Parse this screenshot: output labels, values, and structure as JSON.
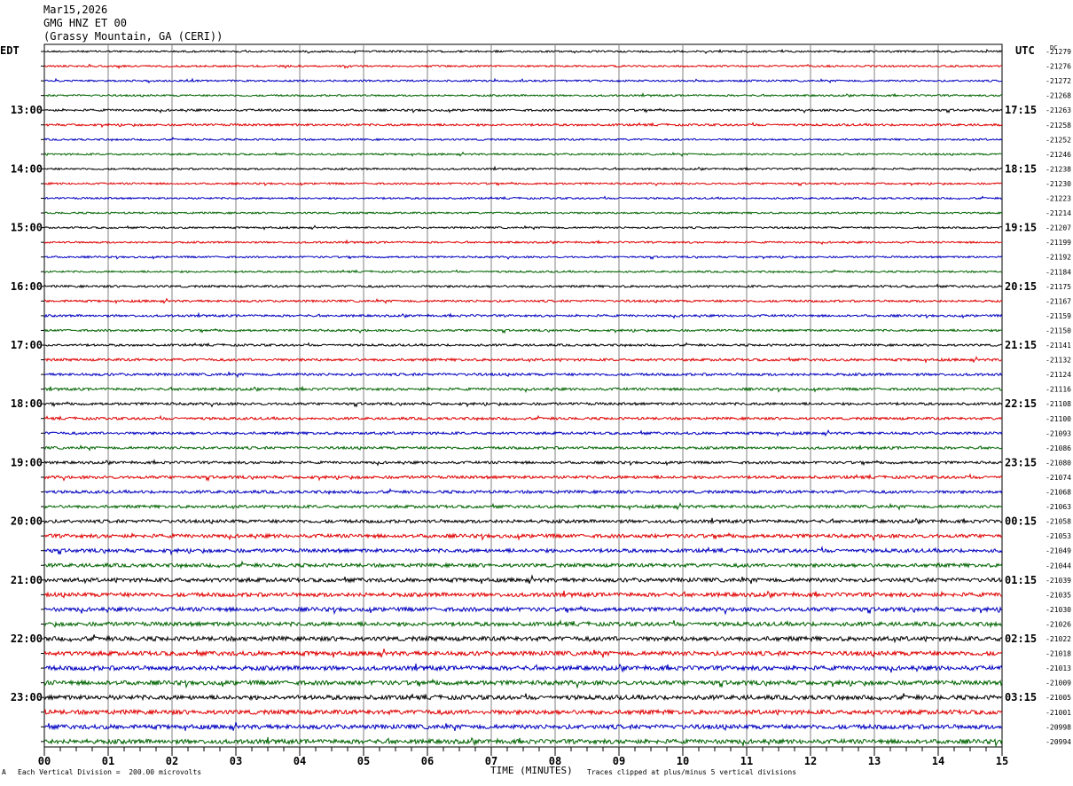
{
  "header": {
    "date": "Mar15,2026",
    "channel": "GMG HNZ ET 00",
    "station": "(Grassy Mountain, GA (CERI))"
  },
  "chart_data": {
    "type": "line",
    "title": "GMG HNZ ET 00",
    "left_axis_label": "EDT",
    "right_axis_label": "UTC",
    "dc_label": "DC",
    "xlabel": "TIME (MINUTES)",
    "xlim": [
      0,
      15
    ],
    "x_ticks": [
      "00",
      "01",
      "02",
      "03",
      "04",
      "05",
      "06",
      "07",
      "08",
      "09",
      "10",
      "11",
      "12",
      "13",
      "14",
      "15"
    ],
    "trace_colors": [
      "#000000",
      "#e00000",
      "#0000c0",
      "#006400"
    ],
    "edt_labels": [
      {
        "row": 4,
        "text": "13:00"
      },
      {
        "row": 8,
        "text": "14:00"
      },
      {
        "row": 12,
        "text": "15:00"
      },
      {
        "row": 16,
        "text": "16:00"
      },
      {
        "row": 20,
        "text": "17:00"
      },
      {
        "row": 24,
        "text": "18:00"
      },
      {
        "row": 28,
        "text": "19:00"
      },
      {
        "row": 32,
        "text": "20:00"
      },
      {
        "row": 36,
        "text": "21:00"
      },
      {
        "row": 40,
        "text": "22:00"
      },
      {
        "row": 44,
        "text": "23:00"
      }
    ],
    "utc_labels": [
      {
        "row": 4,
        "text": "17:15"
      },
      {
        "row": 8,
        "text": "18:15"
      },
      {
        "row": 12,
        "text": "19:15"
      },
      {
        "row": 16,
        "text": "20:15"
      },
      {
        "row": 20,
        "text": "21:15"
      },
      {
        "row": 24,
        "text": "22:15"
      },
      {
        "row": 28,
        "text": "23:15"
      },
      {
        "row": 32,
        "text": "00:15"
      },
      {
        "row": 36,
        "text": "01:15"
      },
      {
        "row": 40,
        "text": "02:15"
      },
      {
        "row": 44,
        "text": "03:15"
      }
    ],
    "dc_offsets": [
      "-21279",
      "-21276",
      "-21272",
      "-21268",
      "-21263",
      "-21258",
      "-21252",
      "-21246",
      "-21238",
      "-21230",
      "-21223",
      "-21214",
      "-21207",
      "-21199",
      "-21192",
      "-21184",
      "-21175",
      "-21167",
      "-21159",
      "-21150",
      "-21141",
      "-21132",
      "-21124",
      "-21116",
      "-21108",
      "-21100",
      "-21093",
      "-21086",
      "-21080",
      "-21074",
      "-21068",
      "-21063",
      "-21058",
      "-21053",
      "-21049",
      "-21044",
      "-21039",
      "-21035",
      "-21030",
      "-21026",
      "-21022",
      "-21018",
      "-21013",
      "-21009",
      "-21005",
      "-21001",
      "-20998",
      "-20994"
    ],
    "trace_amplitude_relative": [
      0.25,
      0.25,
      0.25,
      0.25,
      0.3,
      0.3,
      0.25,
      0.25,
      0.25,
      0.25,
      0.25,
      0.25,
      0.25,
      0.25,
      0.25,
      0.25,
      0.3,
      0.3,
      0.3,
      0.3,
      0.3,
      0.35,
      0.35,
      0.35,
      0.35,
      0.35,
      0.35,
      0.35,
      0.35,
      0.4,
      0.4,
      0.4,
      0.45,
      0.5,
      0.5,
      0.5,
      0.55,
      0.55,
      0.55,
      0.55,
      0.6,
      0.6,
      0.6,
      0.6,
      0.6,
      0.6,
      0.6,
      0.6
    ],
    "grid": true
  },
  "footer": {
    "scale_note": "Each Vertical Division =  200.00 microvolts",
    "clip_note": "Traces clipped at plus/minus 5 vertical divisions",
    "corner_mark": "A"
  }
}
